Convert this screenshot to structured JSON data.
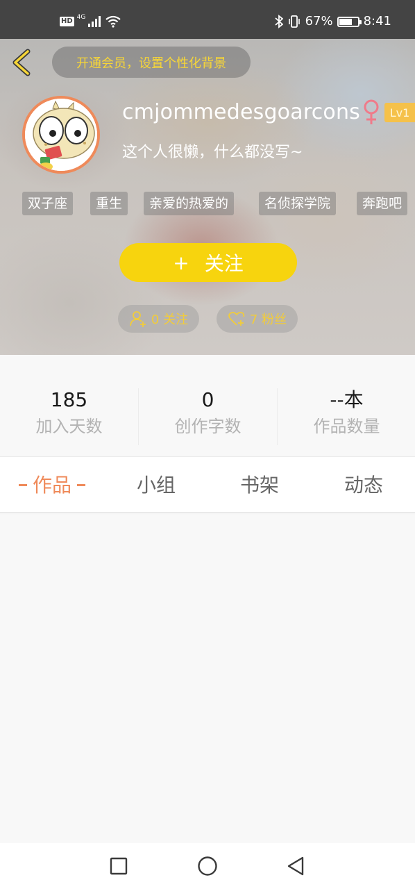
{
  "status_bar": {
    "hd": "HD",
    "network": "4G",
    "battery_percent": "67%",
    "battery_level": 0.67,
    "time": "8:41"
  },
  "header": {
    "vip_banner": "开通会员，设置个性化背景",
    "username": "cmjommedesgoarcons",
    "gender_symbol": "♀",
    "level": "Lv1",
    "bio": "这个人很懒，什么都没写~",
    "tags": [
      "双子座",
      "重生",
      "亲爱的热爱的",
      "名侦探学院",
      "奔跑吧"
    ],
    "follow_button": {
      "plus": "+",
      "label": "关注"
    },
    "following": "0 关注",
    "followers": "7 粉丝",
    "accent_color": "#f7d40e"
  },
  "stats": [
    {
      "value": "185",
      "label": "加入天数"
    },
    {
      "value": "0",
      "label": "创作字数"
    },
    {
      "value": "--本",
      "label": "作品数量"
    }
  ],
  "tabs": [
    {
      "label": "作品",
      "active": true
    },
    {
      "label": "小组",
      "active": false
    },
    {
      "label": "书架",
      "active": false
    },
    {
      "label": "动态",
      "active": false
    }
  ],
  "colors": {
    "active_tab": "#ef8a5a",
    "level_badge": "#f5c14a",
    "vip_text": "#f7d637"
  },
  "nav": {
    "recents": "square-icon",
    "home": "circle-icon",
    "back": "triangle-back-icon"
  }
}
